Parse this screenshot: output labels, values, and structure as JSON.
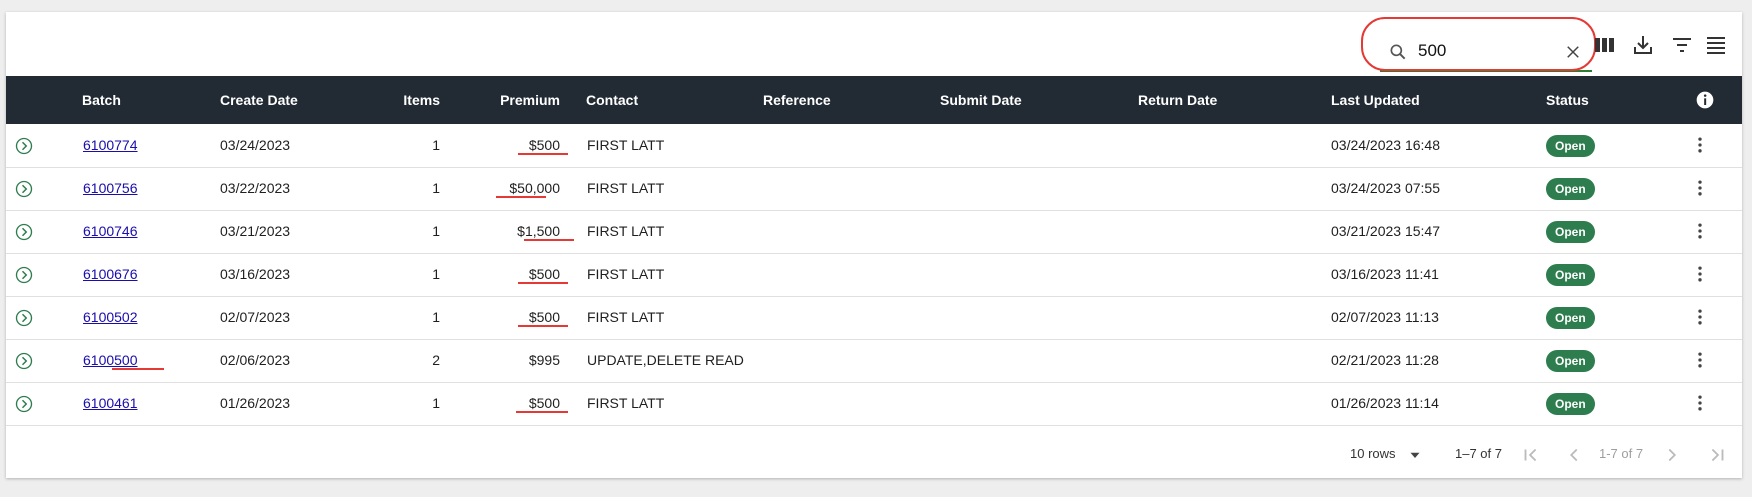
{
  "search": {
    "value": "500",
    "placeholder": ""
  },
  "toolbar": {
    "icons": [
      "search-icon",
      "clear-icon",
      "columns-icon",
      "download-icon",
      "filter-icon",
      "density-icon"
    ]
  },
  "table": {
    "headers": {
      "batch": "Batch",
      "create_date": "Create Date",
      "items": "Items",
      "premium": "Premium",
      "contact": "Contact",
      "reference": "Reference",
      "submit_date": "Submit Date",
      "return_date": "Return Date",
      "last_updated": "Last Updated",
      "status": "Status"
    },
    "rows": [
      {
        "batch": "6100774",
        "create_date": "03/24/2023",
        "items": "1",
        "premium": "$500",
        "contact": "FIRST LATT",
        "reference": "",
        "submit_date": "",
        "return_date": "",
        "last_updated": "03/24/2023 16:48",
        "status": "Open"
      },
      {
        "batch": "6100756",
        "create_date": "03/22/2023",
        "items": "1",
        "premium": "$50,000",
        "contact": "FIRST LATT",
        "reference": "",
        "submit_date": "",
        "return_date": "",
        "last_updated": "03/24/2023 07:55",
        "status": "Open"
      },
      {
        "batch": "6100746",
        "create_date": "03/21/2023",
        "items": "1",
        "premium": "$1,500",
        "contact": "FIRST LATT",
        "reference": "",
        "submit_date": "",
        "return_date": "",
        "last_updated": "03/21/2023 15:47",
        "status": "Open"
      },
      {
        "batch": "6100676",
        "create_date": "03/16/2023",
        "items": "1",
        "premium": "$500",
        "contact": "FIRST LATT",
        "reference": "",
        "submit_date": "",
        "return_date": "",
        "last_updated": "03/16/2023 11:41",
        "status": "Open"
      },
      {
        "batch": "6100502",
        "create_date": "02/07/2023",
        "items": "1",
        "premium": "$500",
        "contact": "FIRST LATT",
        "reference": "",
        "submit_date": "",
        "return_date": "",
        "last_updated": "02/07/2023 11:13",
        "status": "Open"
      },
      {
        "batch": "6100500",
        "create_date": "02/06/2023",
        "items": "2",
        "premium": "$995",
        "contact": "UPDATE,DELETE READ",
        "reference": "",
        "submit_date": "",
        "return_date": "",
        "last_updated": "02/21/2023 11:28",
        "status": "Open"
      },
      {
        "batch": "6100461",
        "create_date": "01/26/2023",
        "items": "1",
        "premium": "$500",
        "contact": "FIRST LATT",
        "reference": "",
        "submit_date": "",
        "return_date": "",
        "last_updated": "01/26/2023 11:14",
        "status": "Open"
      }
    ]
  },
  "footer": {
    "rows_per_page": "10 rows",
    "range_label": "1–7 of 7",
    "page_label": "1-7 of 7"
  },
  "colors": {
    "header_bg": "#222b34",
    "status_bg": "#2e7d4f",
    "link": "#1a0dab",
    "annotation": "#e53935",
    "search_underline": "#2e7d32"
  }
}
